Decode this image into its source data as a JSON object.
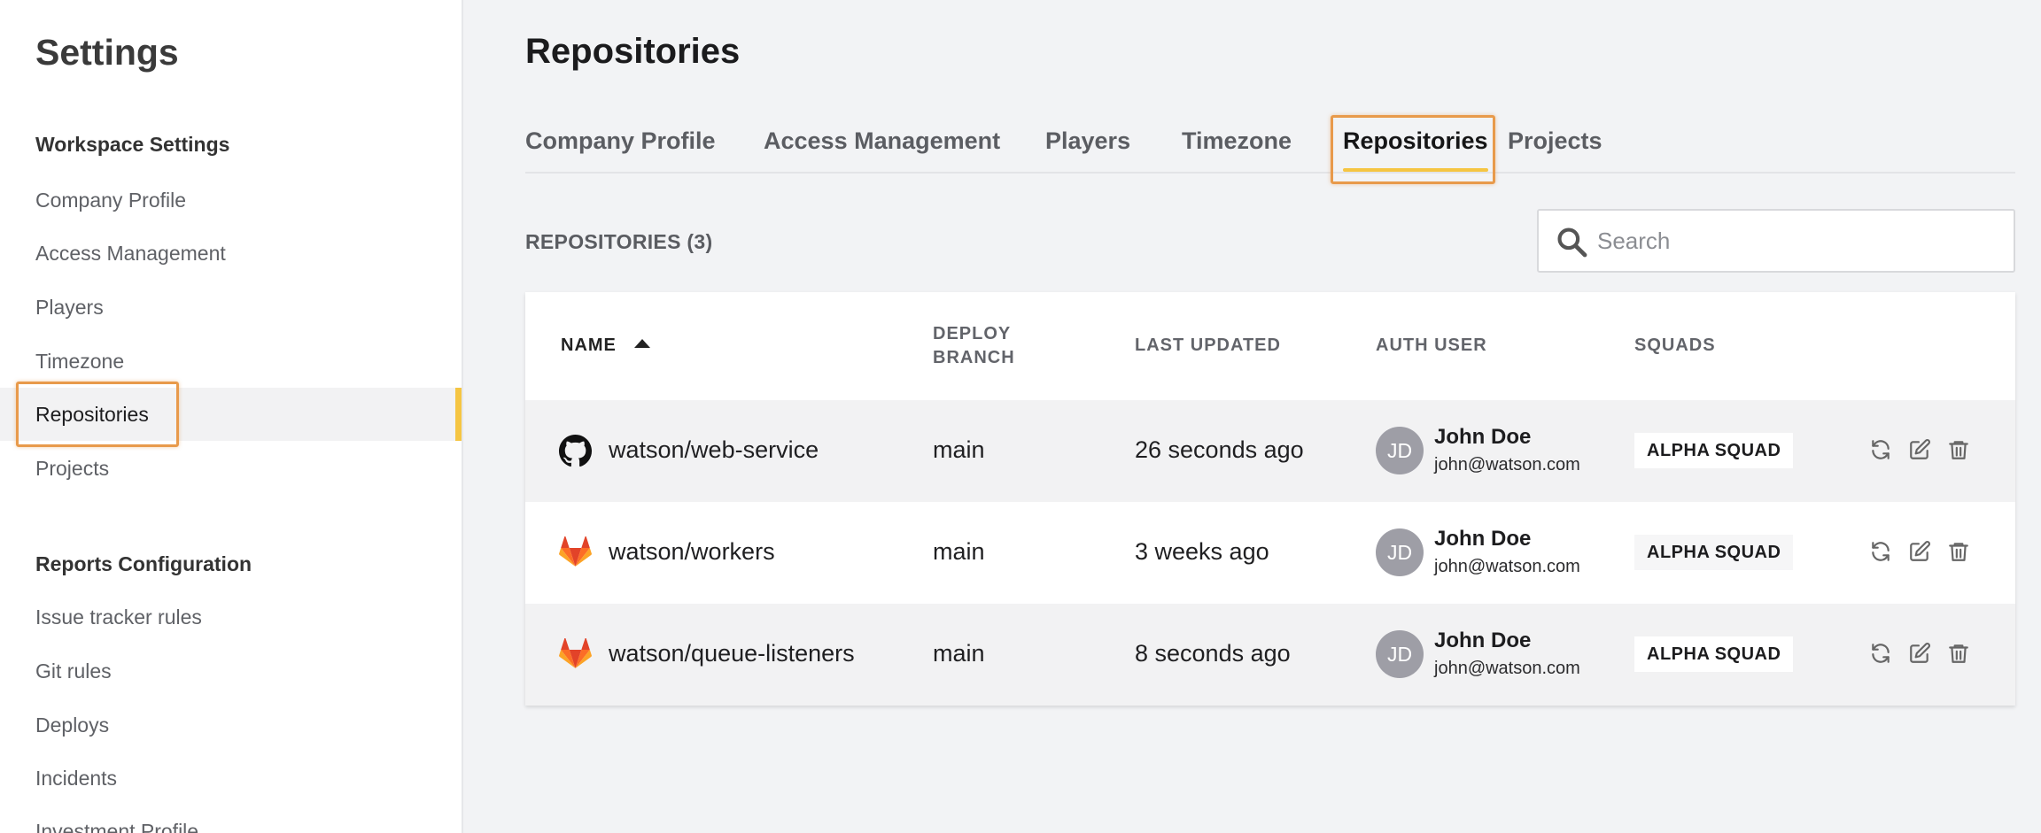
{
  "sidebar": {
    "title": "Settings",
    "sections": [
      {
        "title": "Workspace Settings",
        "items": [
          "Company Profile",
          "Access Management",
          "Players",
          "Timezone",
          "Repositories",
          "Projects"
        ]
      },
      {
        "title": "Reports Configuration",
        "items": [
          "Issue tracker rules",
          "Git rules",
          "Deploys",
          "Incidents",
          "Investment Profile"
        ]
      }
    ],
    "active_item": "Repositories",
    "accent_color": "#f5c542"
  },
  "main": {
    "title": "Repositories",
    "tabs": [
      "Company Profile",
      "Access Management",
      "Players",
      "Timezone",
      "Repositories",
      "Projects"
    ],
    "active_tab": "Repositories",
    "count_label": "REPOSITORIES (3)",
    "search": {
      "placeholder": "Search",
      "value": ""
    }
  },
  "table": {
    "headers": {
      "name": "NAME",
      "deploy_branch_1": "DEPLOY",
      "deploy_branch_2": "BRANCH",
      "last_updated": "LAST UPDATED",
      "auth_user": "AUTH USER",
      "squads": "SQUADS"
    },
    "sort": {
      "column": "name",
      "direction": "ascending"
    },
    "rows": [
      {
        "provider": "github-icon",
        "name": "watson/web-service",
        "branch": "main",
        "updated": "26 seconds ago",
        "initials": "JD",
        "user": "John Doe",
        "email": "john@watson.com",
        "squad": "ALPHA SQUAD"
      },
      {
        "provider": "gitlab-icon",
        "name": "watson/workers",
        "branch": "main",
        "updated": "3 weeks ago",
        "initials": "JD",
        "user": "John Doe",
        "email": "john@watson.com",
        "squad": "ALPHA SQUAD"
      },
      {
        "provider": "gitlab-icon",
        "name": "watson/queue-listeners",
        "branch": "main",
        "updated": "8 seconds ago",
        "initials": "JD",
        "user": "John Doe",
        "email": "john@watson.com",
        "squad": "ALPHA SQUAD"
      }
    ],
    "row_actions": [
      "sync-icon",
      "edit-icon",
      "delete-icon"
    ]
  }
}
